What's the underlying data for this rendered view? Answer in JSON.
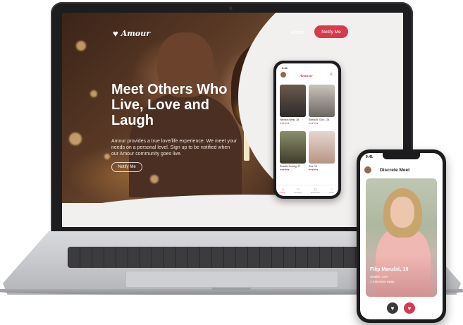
{
  "site": {
    "logo_text": "Amour",
    "nav": {
      "about": "About",
      "notify": "Notify Me"
    },
    "hero": {
      "title": "Meet Others Who Live, Love and Laugh",
      "text": "Amour provides a true love/life experience. We meet your needs on a personal level. Sign up to be notified when our Amour community goes live.",
      "cta": "Notify Me"
    }
  },
  "small_phone": {
    "time": "9:41",
    "logo_text": "Amour",
    "cards": [
      {
        "name": "Harmon West, 28",
        "hearts": "♥♥♥♥♥♥"
      },
      {
        "name": "Sheila B. Gon.., 25",
        "hearts": "♥♥♥♥♥♥"
      },
      {
        "name": "Rosalie Koenig, 27",
        "hearts": "♥♥♥♥♥♥"
      },
      {
        "name": "Eva, 19",
        "hearts": "♥♥♥♥♥♥"
      }
    ],
    "tabs": [
      "Home",
      "Messages",
      "Notifications",
      "Profile"
    ]
  },
  "big_phone": {
    "time": "9:41",
    "title": "Discrete Meet",
    "profile": {
      "name": "Filip Marušić, 19",
      "location": "Seattle, USA",
      "distance": "1 Kilometre away"
    }
  },
  "colors": {
    "accent": "#d63a4f",
    "dark": "#1c1c1e",
    "page_bg": "#f2f0ef"
  }
}
